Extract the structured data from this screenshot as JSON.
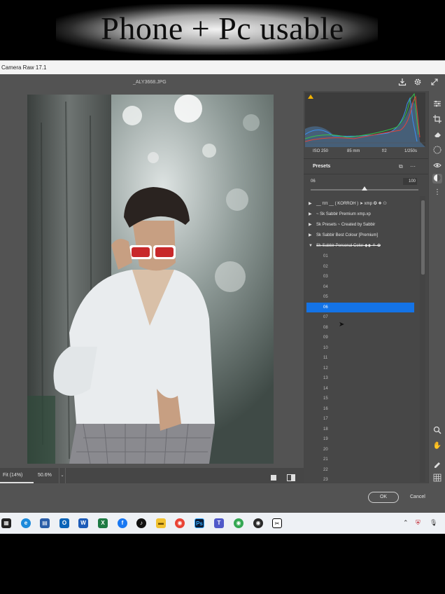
{
  "banner": {
    "title": "Phone + Pc usable"
  },
  "window": {
    "title": "Camera Raw 17.1"
  },
  "document": {
    "filename": "_ALY3668.JPG"
  },
  "top_icons": [
    "download-icon",
    "gear-icon",
    "expand-icon"
  ],
  "histogram": {
    "exif": {
      "iso": "ISO 250",
      "focal": "85 mm",
      "aperture": "f/2",
      "shutter": "1/250s"
    },
    "colors": {
      "red": "#e0443a",
      "green": "#34c24a",
      "blue": "#3a8ff0"
    }
  },
  "presets": {
    "title": "Presets",
    "amount_value": "06",
    "amount_max": "100",
    "amount_fraction": 0.5,
    "groups": [
      {
        "label": "__ ππ __ ( KORROH ) ➤ xmp ✪ ❖ ⚇",
        "expanded": false
      },
      {
        "label": "~ Sk Sabbir Premium xmp.xp",
        "expanded": false
      },
      {
        "label": "Sk Presets ~ Created by Sabbir",
        "expanded": false
      },
      {
        "label": "Sk Sabbir Best Colour [Premium]",
        "expanded": false
      },
      {
        "label": "Sk Sabbir Personal Color ◆◆ ⚘ ✿",
        "expanded": true
      }
    ],
    "items": [
      "01",
      "02",
      "03",
      "04",
      "05",
      "06",
      "07",
      "08",
      "09",
      "10",
      "11",
      "12",
      "13",
      "14",
      "15",
      "16",
      "17",
      "18",
      "19",
      "20",
      "21",
      "22",
      "23"
    ],
    "selected": "06"
  },
  "view": {
    "fit_label": "Fit (14%)",
    "zoom_label": "50.6%"
  },
  "footer": {
    "ok_label": "OK",
    "cancel_label": "Cancel"
  },
  "tools": [
    "edit-sliders-icon",
    "crop-icon",
    "eraser-icon",
    "masking-icon",
    "redeye-icon",
    "presets-icon",
    "more-icon",
    "zoom-icon",
    "hand-icon",
    "color-sampler-icon",
    "grid-icon"
  ],
  "taskbar": {
    "apps": [
      "start",
      "edge",
      "store",
      "outlook",
      "word",
      "excel",
      "facebook",
      "tiktok",
      "explorer",
      "chrome",
      "photoshop",
      "teams",
      "chrome-profile",
      "chrome-notif",
      "capcut"
    ]
  }
}
